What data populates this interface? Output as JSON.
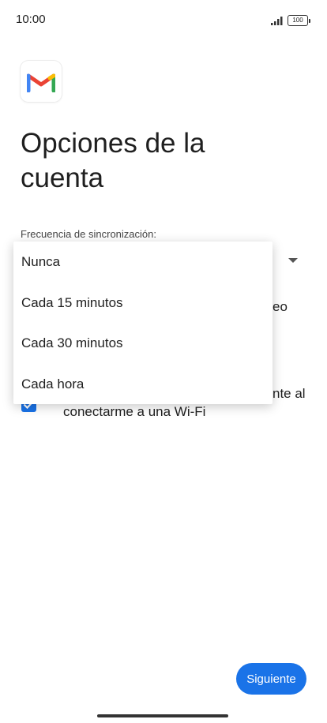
{
  "status_bar": {
    "time": "10:00",
    "battery_level": "100"
  },
  "header": {
    "logo_icon": "gmail-logo-icon",
    "title": "Opciones de la cuenta"
  },
  "form": {
    "sync_label": "Frecuencia de sincronización:",
    "partial_text_right_1": "eo",
    "partial_text_right_2": "nte al",
    "wifi_checkbox_label": "conectarme a una Wi-Fi",
    "wifi_checkbox_checked": true
  },
  "dropdown": {
    "options": [
      "Nunca",
      "Cada 15 minutos",
      "Cada 30 minutos",
      "Cada hora"
    ]
  },
  "footer": {
    "next_label": "Siguiente"
  },
  "colors": {
    "accent": "#1a73e8",
    "gmail_red": "#ea4335",
    "gmail_blue": "#4285f4",
    "gmail_green": "#34a853",
    "gmail_yellow": "#fbbc04"
  }
}
